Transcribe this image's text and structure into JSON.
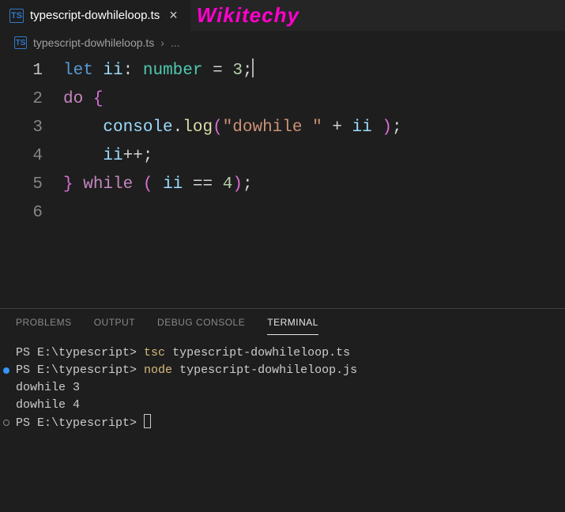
{
  "tab": {
    "filename": "typescript-dowhileloop.ts",
    "icon_label": "TS"
  },
  "watermark": "Wikitechy",
  "breadcrumb": {
    "filename": "typescript-dowhileloop.ts",
    "ellipsis": "..."
  },
  "code": {
    "lines": [
      {
        "num": "1",
        "active": true
      },
      {
        "num": "2"
      },
      {
        "num": "3"
      },
      {
        "num": "4"
      },
      {
        "num": "5"
      },
      {
        "num": "6"
      }
    ],
    "t_let": "let",
    "t_var_ii": "ii",
    "t_colon": ":",
    "t_type_number": "number",
    "t_eq": "=",
    "t_3": "3",
    "t_semi": ";",
    "t_do": "do",
    "t_lbrace": "{",
    "t_console": "console",
    "t_dot": ".",
    "t_log": "log",
    "t_lparen": "(",
    "t_str_dowhile": "\"dowhile \"",
    "t_plus": "+",
    "t_rparen": ")",
    "t_incr": "++",
    "t_rbrace": "}",
    "t_while": "while",
    "t_eqeq": "==",
    "t_4": "4"
  },
  "panel": {
    "tabs": {
      "problems": "PROBLEMS",
      "output": "OUTPUT",
      "debug": "DEBUG CONSOLE",
      "terminal": "TERMINAL"
    }
  },
  "terminal": {
    "prompt": "PS E:\\typescript>",
    "cmd1_a": "tsc",
    "cmd1_b": "typescript-dowhileloop.ts",
    "cmd2_a": "node",
    "cmd2_b": "typescript-dowhileloop.js",
    "out1": "dowhile 3",
    "out2": "dowhile 4"
  }
}
